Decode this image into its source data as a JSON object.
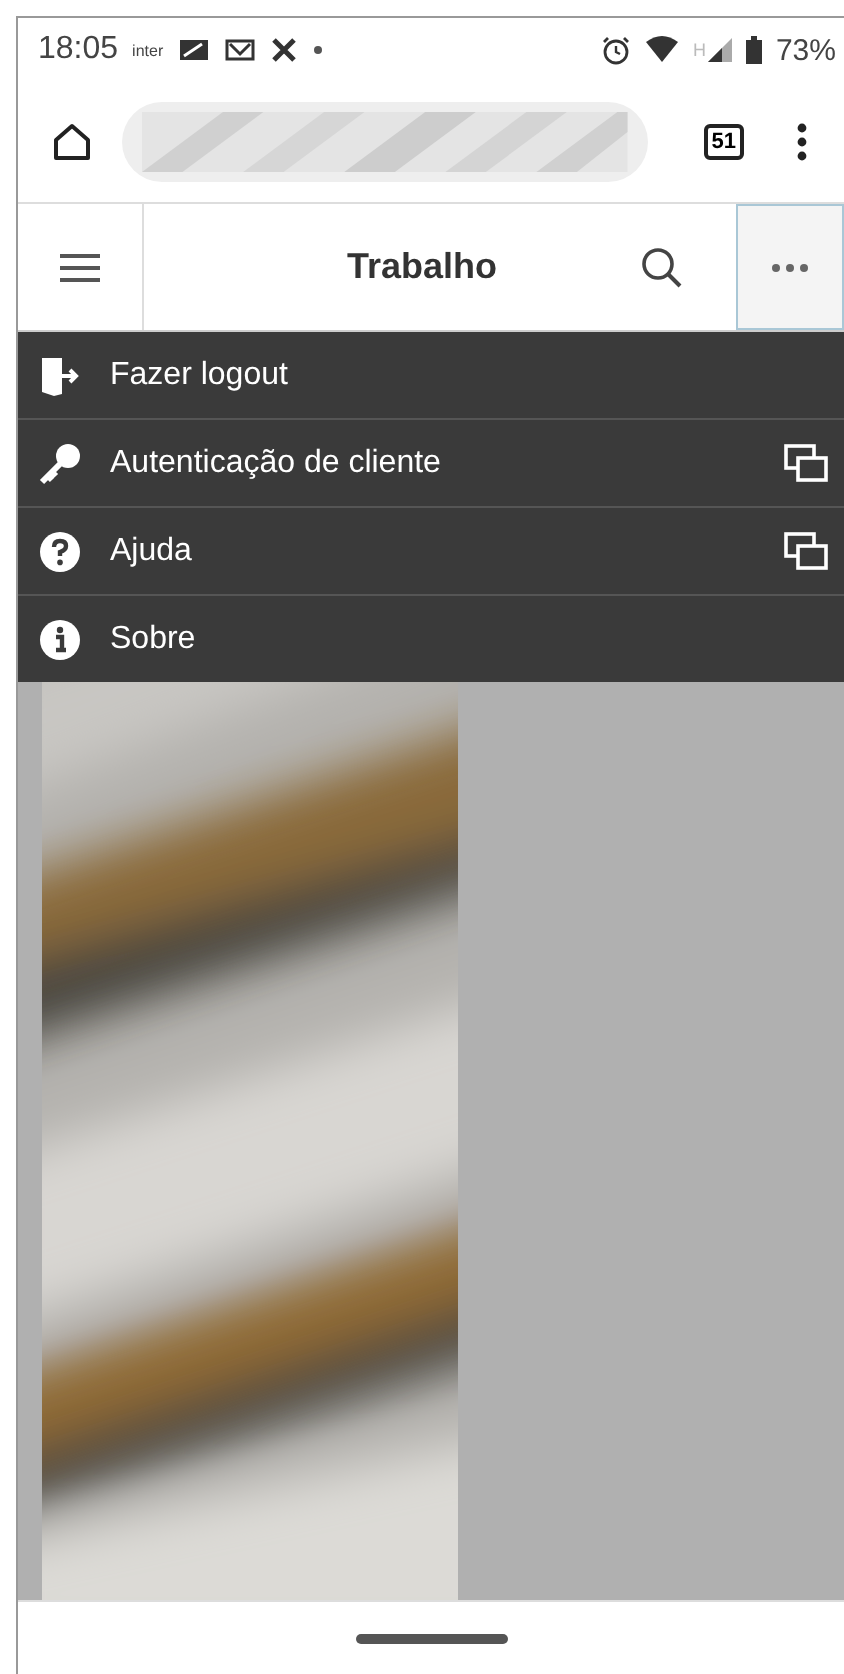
{
  "status_bar": {
    "time": "18:05",
    "carrier": "inter",
    "battery": "73%",
    "network": "H"
  },
  "browser": {
    "tab_count": "51"
  },
  "app_bar": {
    "title": "Trabalho",
    "more_selected": true
  },
  "menu": [
    {
      "label": "Fazer logout",
      "new_window": false
    },
    {
      "label": "Autenticação de cliente",
      "new_window": true
    },
    {
      "label": "Ajuda",
      "new_window": true
    },
    {
      "label": "Sobre",
      "new_window": false
    }
  ]
}
